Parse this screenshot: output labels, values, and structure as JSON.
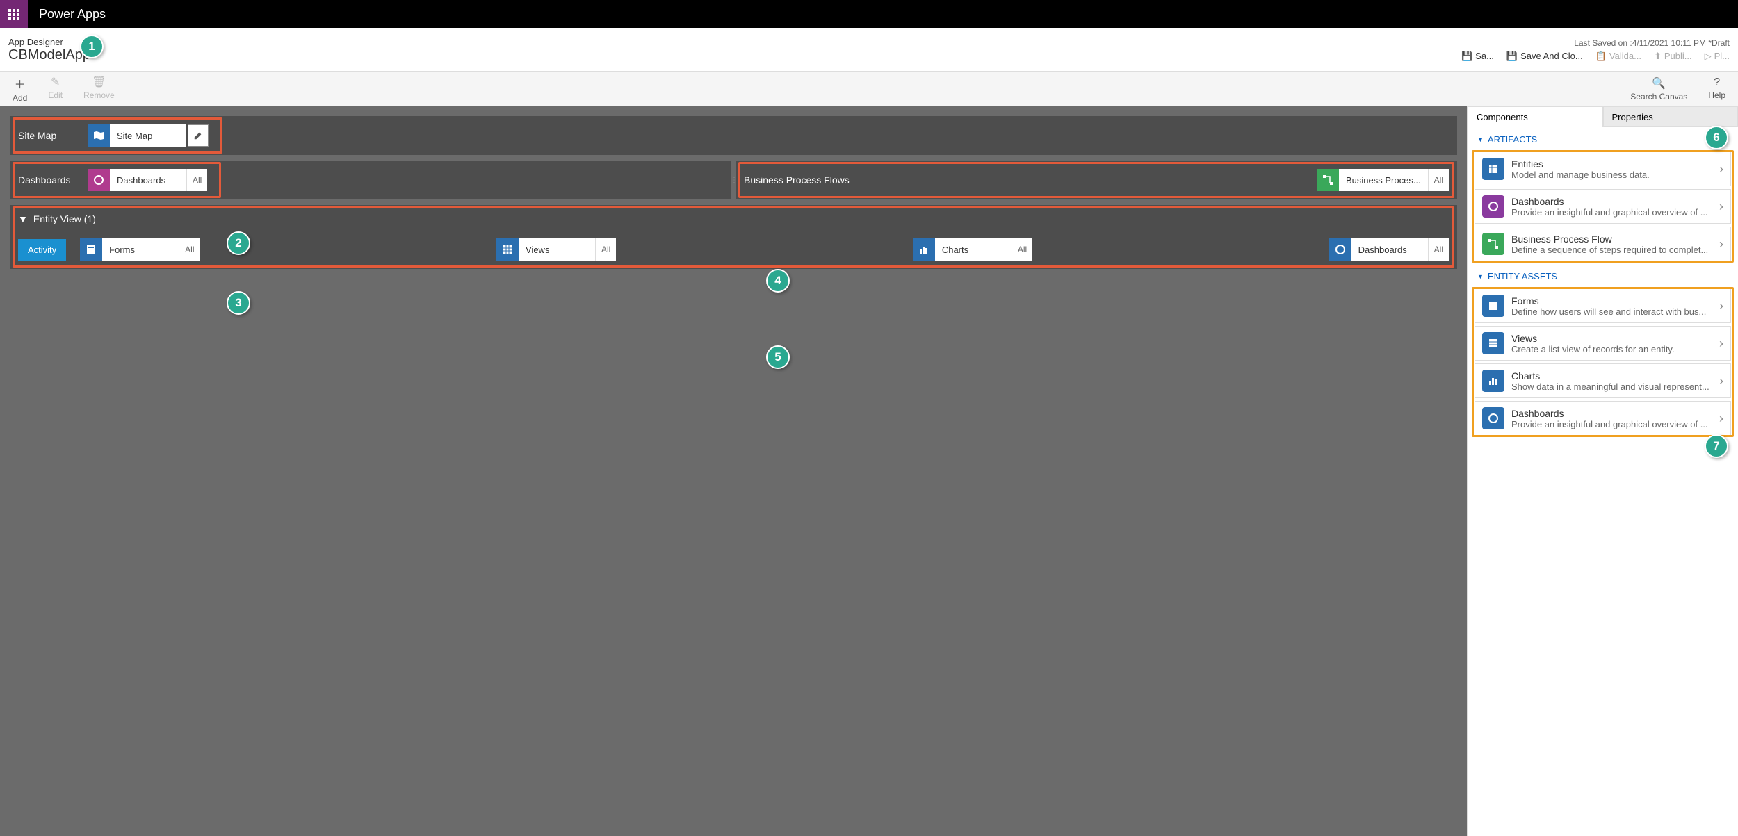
{
  "brand": "Power Apps",
  "header": {
    "designer_label": "App Designer",
    "app_name": "CBModelApp *",
    "last_saved": "Last Saved on :4/11/2021 10:11 PM *Draft",
    "actions": {
      "save": "Sa...",
      "save_close": "Save And Clo...",
      "validate": "Valida...",
      "publish": "Publi...",
      "play": "Pl..."
    }
  },
  "toolbar": {
    "add": "Add",
    "edit": "Edit",
    "remove": "Remove",
    "search": "Search Canvas",
    "help": "Help"
  },
  "canvas": {
    "sitemap_label": "Site Map",
    "sitemap_tile": "Site Map",
    "dashboards_label": "Dashboards",
    "dashboards_tile": "Dashboards",
    "dashboards_all": "All",
    "bpf_label": "Business Process Flows",
    "bpf_tile": "Business Proces...",
    "bpf_all": "All",
    "entity_header": "Entity View (1)",
    "activity": "Activity",
    "forms": "Forms",
    "forms_all": "All",
    "views": "Views",
    "views_all": "All",
    "charts": "Charts",
    "charts_all": "All",
    "ent_dash": "Dashboards",
    "ent_dash_all": "All"
  },
  "rightpanel": {
    "tab_components": "Components",
    "tab_properties": "Properties",
    "section_artifacts": "ARTIFACTS",
    "section_entity_assets": "ENTITY ASSETS",
    "artifacts": {
      "entities_title": "Entities",
      "entities_desc": "Model and manage business data.",
      "dashboards_title": "Dashboards",
      "dashboards_desc": "Provide an insightful and graphical overview of ...",
      "bpf_title": "Business Process Flow",
      "bpf_desc": "Define a sequence of steps required to complet..."
    },
    "assets": {
      "forms_title": "Forms",
      "forms_desc": "Define how users will see and interact with bus...",
      "views_title": "Views",
      "views_desc": "Create a list view of records for an entity.",
      "charts_title": "Charts",
      "charts_desc": "Show data in a meaningful and visual represent...",
      "dash_title": "Dashboards",
      "dash_desc": "Provide an insightful and graphical overview of ..."
    }
  },
  "callouts": [
    "1",
    "2",
    "3",
    "4",
    "5",
    "6",
    "7"
  ]
}
